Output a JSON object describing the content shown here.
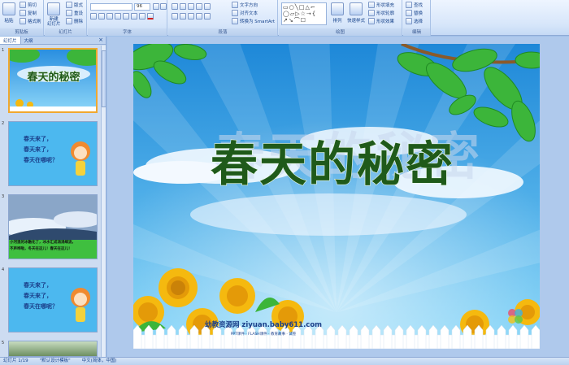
{
  "ribbon": {
    "clipboard": {
      "paste": "粘贴",
      "cut": "剪切",
      "copy": "复制",
      "format_painter": "格式刷",
      "label": "剪贴板"
    },
    "slides": {
      "new_slide": "新建\n幻灯片",
      "layout": "版式",
      "reset": "重设",
      "delete": "删除",
      "label": "幻灯片"
    },
    "font": {
      "font_name": "",
      "font_size": "96",
      "label": "字体"
    },
    "paragraph": {
      "text_direction": "文字方向",
      "align_text": "对齐文本",
      "convert_smartart": "转换为 SmartArt",
      "label": "段落"
    },
    "drawing": {
      "arrange": "排列",
      "quick_styles": "快速样式",
      "shape_fill": "形状填充",
      "shape_outline": "形状轮廓",
      "shape_effects": "形状效果",
      "label": "绘图"
    },
    "editing": {
      "find": "查找",
      "replace": "替换",
      "select": "选择",
      "label": "编辑"
    }
  },
  "panel": {
    "tabs": [
      "幻灯片",
      "大纲"
    ],
    "slides": [
      {
        "num": "1",
        "kind": "title",
        "title": "春天的秘密"
      },
      {
        "num": "2",
        "kind": "text",
        "lines": [
          "春天来了，",
          "春天来了，",
          "春天在哪呢？"
        ]
      },
      {
        "num": "3",
        "kind": "photo",
        "caption_lines": [
          "小河里的冰融化了，冰水汇成涓涓细流，",
          "不声哗啦，冬天在这儿！春天在这儿！"
        ]
      },
      {
        "num": "4",
        "kind": "text",
        "lines": [
          "春天来了，",
          "春天来了，",
          "春天在哪呢？"
        ]
      },
      {
        "num": "5",
        "kind": "photo2"
      }
    ]
  },
  "slide": {
    "title": "春天的秘密",
    "ghost_title": "春天的秘密",
    "watermark": "幼教资源网 ziyuan.baby611.com",
    "watermark_sub": "PPT课件 · FLASH课件 · 教育故事 · 试卷"
  },
  "status": {
    "slide_info": "幻灯片 1/19",
    "theme": "\"默认设计模板\"",
    "language": "中文(简体，中国)"
  },
  "colors": {
    "sky_top": "#1e88d8",
    "sky_bottom": "#7fd4f8",
    "title_green": "#1f5a1a",
    "leaf_green": "#3cb53a",
    "sunflower": "#f5b90f"
  }
}
